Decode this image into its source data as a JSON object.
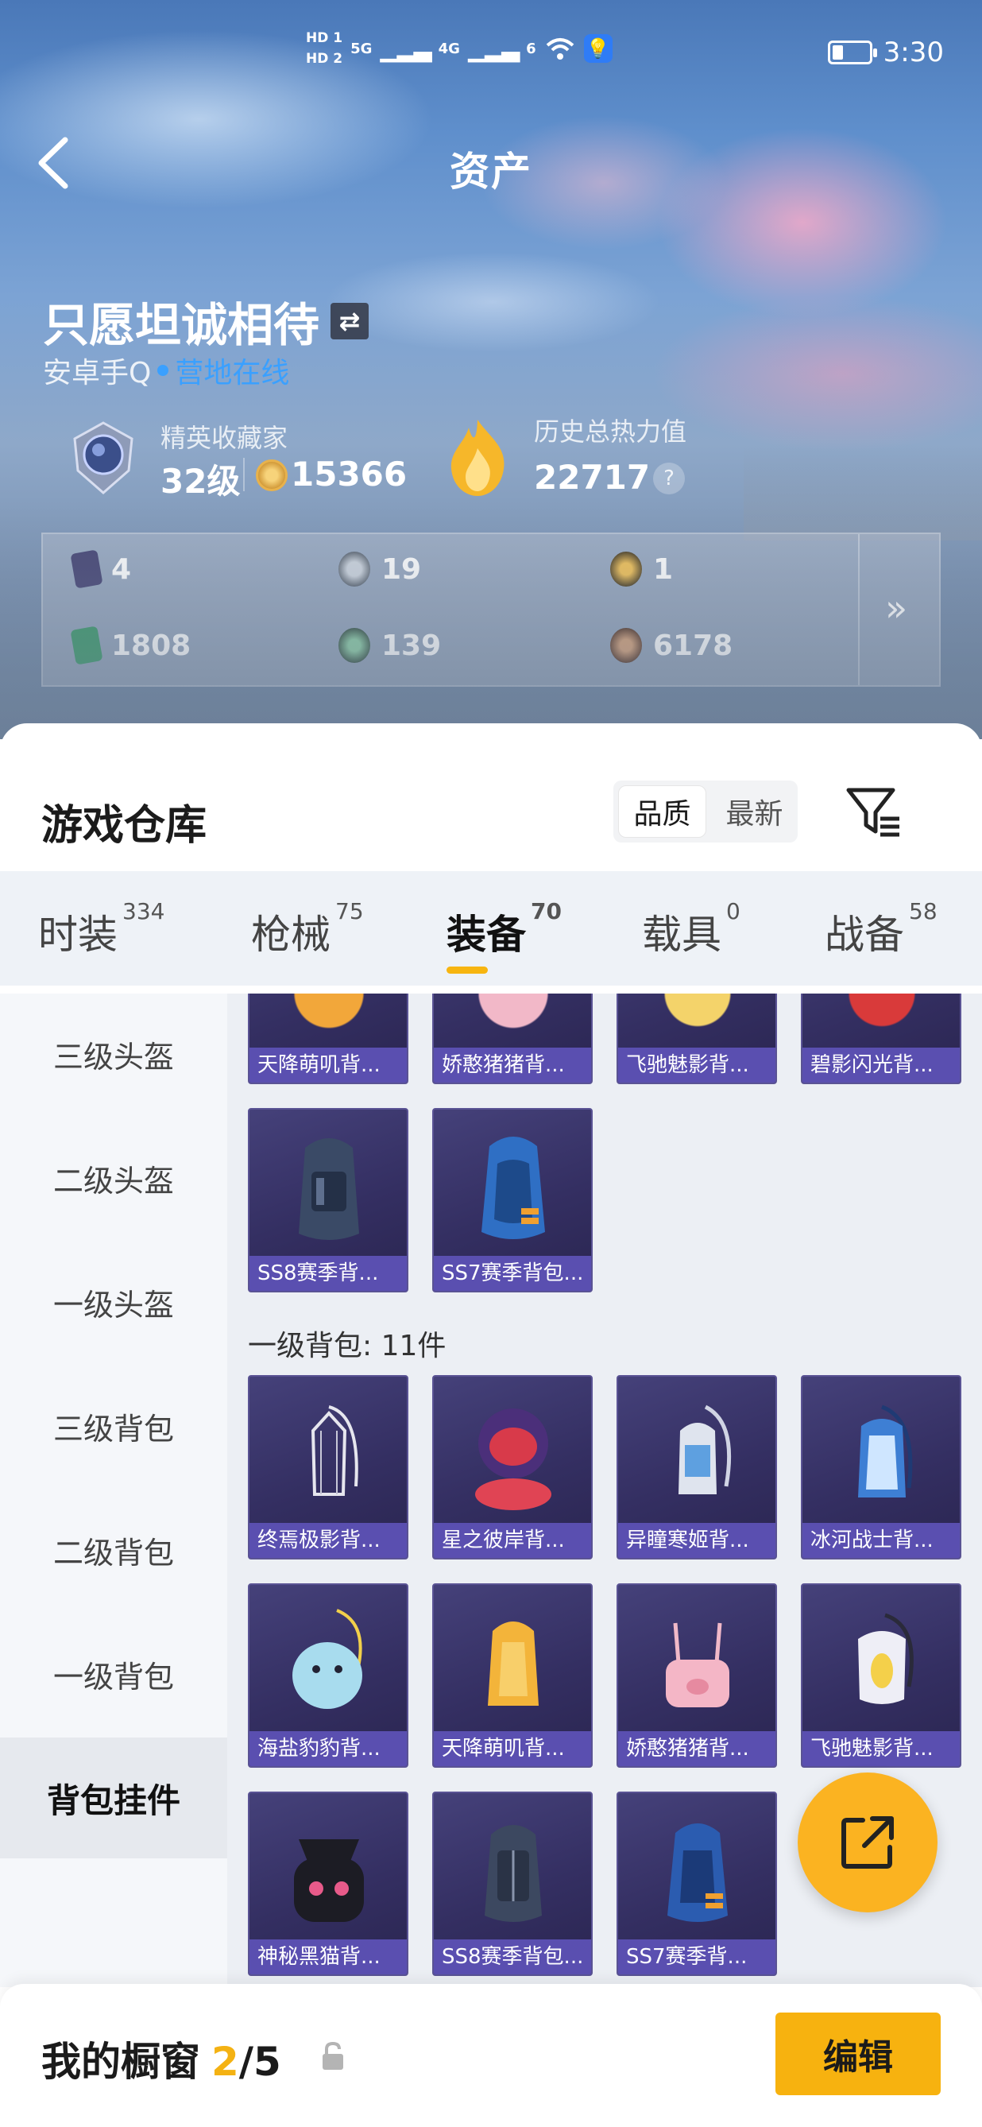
{
  "status_bar": {
    "hd1": "HD 1",
    "hd2": "HD 2",
    "net1": "5G",
    "net2": "4G",
    "wifi_label": "6",
    "battery_level": 0.3,
    "time": "3:30"
  },
  "header": {
    "title": "资产"
  },
  "profile": {
    "username": "只愿坦诚相待",
    "platform": "安卓手Q",
    "online_status": "营地在线",
    "rank_title": "精英收藏家",
    "level": "32级",
    "coins": "15366",
    "heat_title": "历史总热力值",
    "heat_value": "22717",
    "help": "?"
  },
  "stats": [
    {
      "icon": "card-icon",
      "value": "4"
    },
    {
      "icon": "silver-medal-icon",
      "value": "19"
    },
    {
      "icon": "gold-medal-icon",
      "value": "1"
    },
    {
      "icon": "ticket-icon",
      "value": "1808"
    },
    {
      "icon": "green-orb-icon",
      "value": "139"
    },
    {
      "icon": "bronze-orb-icon",
      "value": "6178"
    }
  ],
  "stats_more": "»",
  "warehouse": {
    "title": "游戏仓库",
    "sort_options": [
      "品质",
      "最新"
    ],
    "sort_active": "品质"
  },
  "tabs": [
    {
      "label": "时装",
      "count": "334"
    },
    {
      "label": "枪械",
      "count": "75"
    },
    {
      "label": "装备",
      "count": "70"
    },
    {
      "label": "载具",
      "count": "0"
    },
    {
      "label": "战备",
      "count": "58"
    }
  ],
  "active_tab": "装备",
  "sidebar": [
    {
      "label": "三级头盔"
    },
    {
      "label": "二级头盔"
    },
    {
      "label": "一级头盔"
    },
    {
      "label": "三级背包"
    },
    {
      "label": "二级背包"
    },
    {
      "label": "一级背包"
    },
    {
      "label": "背包挂件"
    }
  ],
  "grid": {
    "top_row": [
      "天降萌叽背...",
      "娇憨猪猪背...",
      "飞驰魅影背...",
      "碧影闪光背..."
    ],
    "second_row": [
      "SS8赛季背...",
      "SS7赛季背包..."
    ],
    "section_label": "一级背包: 11件",
    "level1_items": [
      "终焉极影背...",
      "星之彼岸背...",
      "异瞳寒姬背...",
      "冰河战士背...",
      "海盐豹豹背...",
      "天降萌叽背...",
      "娇憨猪猪背...",
      "飞驰魅影背...",
      "神秘黑猫背...",
      "SS8赛季背包...",
      "SS7赛季背..."
    ]
  },
  "bottom_bar": {
    "label": "我的橱窗",
    "count_current": "2",
    "count_sep": "/5",
    "edit_label": "编辑"
  },
  "colors": {
    "accent": "#f7b20f",
    "online": "#3aa0ff",
    "card_bg": "#342f62",
    "card_label": "#5a4fb0"
  }
}
